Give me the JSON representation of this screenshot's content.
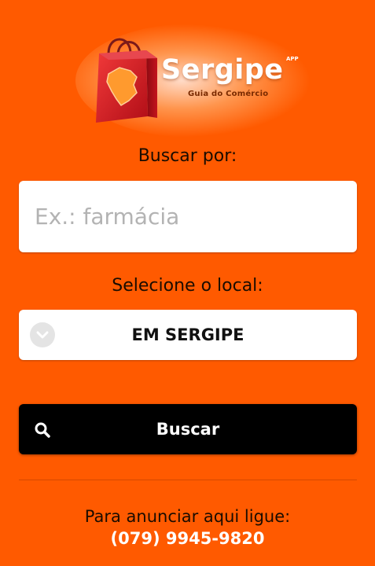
{
  "brand": {
    "name": "Sergipe",
    "badge": "APP",
    "tagline": "Guia do Comércio"
  },
  "search": {
    "label": "Buscar por:",
    "placeholder": "Ex.: farmácia",
    "value": ""
  },
  "location": {
    "label": "Selecione o local:",
    "selected": "EM SERGIPE"
  },
  "actions": {
    "search_button": "Buscar"
  },
  "footer": {
    "text": "Para anunciar aqui ligue:",
    "phone": "(079) 9945-9820"
  },
  "colors": {
    "background": "#FF5A00",
    "button": "#000000",
    "bag": "#D9151F"
  }
}
